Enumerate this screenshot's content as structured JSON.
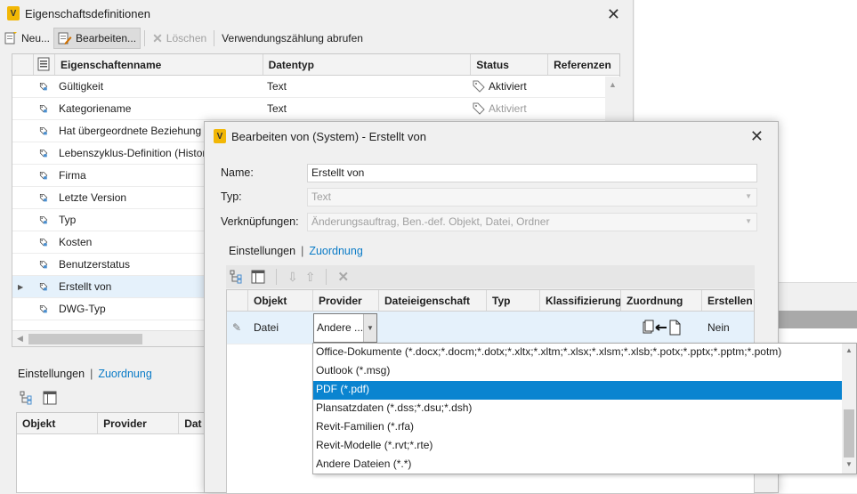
{
  "main_window": {
    "title": "Eigenschaftsdefinitionen",
    "toolbar": {
      "new_label": "Neu...",
      "edit_label": "Bearbeiten...",
      "delete_label": "Löschen",
      "usage_label": "Verwendungszählung abrufen"
    },
    "grid": {
      "columns": [
        "Eigenschaftenname",
        "Datentyp",
        "Status",
        "Referenzen"
      ],
      "rows": [
        {
          "name": "Gültigkeit",
          "datatype": "Text",
          "status": "Aktiviert"
        },
        {
          "name": "Kategoriename",
          "datatype": "Text",
          "status": "Aktiviert"
        },
        {
          "name": "Hat übergeordnete Beziehung",
          "datatype": "",
          "status": ""
        },
        {
          "name": "Lebenszyklus-Definition (Histor",
          "datatype": "",
          "status": ""
        },
        {
          "name": "Firma",
          "datatype": "",
          "status": ""
        },
        {
          "name": "Letzte Version",
          "datatype": "",
          "status": ""
        },
        {
          "name": "Typ",
          "datatype": "",
          "status": ""
        },
        {
          "name": "Kosten",
          "datatype": "",
          "status": ""
        },
        {
          "name": "Benutzerstatus",
          "datatype": "",
          "status": ""
        },
        {
          "name": "Erstellt von",
          "datatype": "",
          "status": ""
        },
        {
          "name": "DWG-Typ",
          "datatype": "",
          "status": ""
        }
      ]
    },
    "bottom_tabs": {
      "settings": "Einstellungen",
      "mapping": "Zuordnung"
    },
    "bottom_grid": {
      "columns": [
        "Objekt",
        "Provider",
        "Dat"
      ]
    }
  },
  "dialog": {
    "title": "Bearbeiten von (System) - Erstellt von",
    "name_label": "Name:",
    "name_value": "Erstellt von",
    "type_label": "Typ:",
    "type_value": "Text",
    "links_label": "Verknüpfungen:",
    "links_value": "Änderungsauftrag, Ben.-def. Objekt, Datei, Ordner",
    "tabs": {
      "settings": "Einstellungen",
      "mapping": "Zuordnung"
    },
    "mapping_grid": {
      "columns": [
        "Objekt",
        "Provider",
        "Dateieigenschaft",
        "Typ",
        "Klassifizierung",
        "Zuordnung",
        "Erstellen"
      ],
      "row": {
        "object": "Datei",
        "provider": "Andere ...",
        "create": "Nein"
      }
    }
  },
  "provider_dropdown": {
    "items": [
      "Office-Dokumente (*.docx;*.docm;*.dotx;*.xltx;*.xltm;*.xlsx;*.xlsm;*.xlsb;*.potx;*.pptx;*.pptm;*.potm)",
      "Outlook (*.msg)",
      "PDF (*.pdf)",
      "Plansatzdaten (*.dss;*.dsu;*.dsh)",
      "Revit-Familien (*.rfa)",
      "Revit-Modelle (*.rvt;*.rte)",
      "Andere Dateien (*.*)"
    ],
    "highlighted_index": 2
  },
  "colors": {
    "link": "#0a7bc7",
    "highlight": "#0a84d0",
    "selected_row": "#e5f1fb",
    "app_icon": "#f2b705"
  }
}
